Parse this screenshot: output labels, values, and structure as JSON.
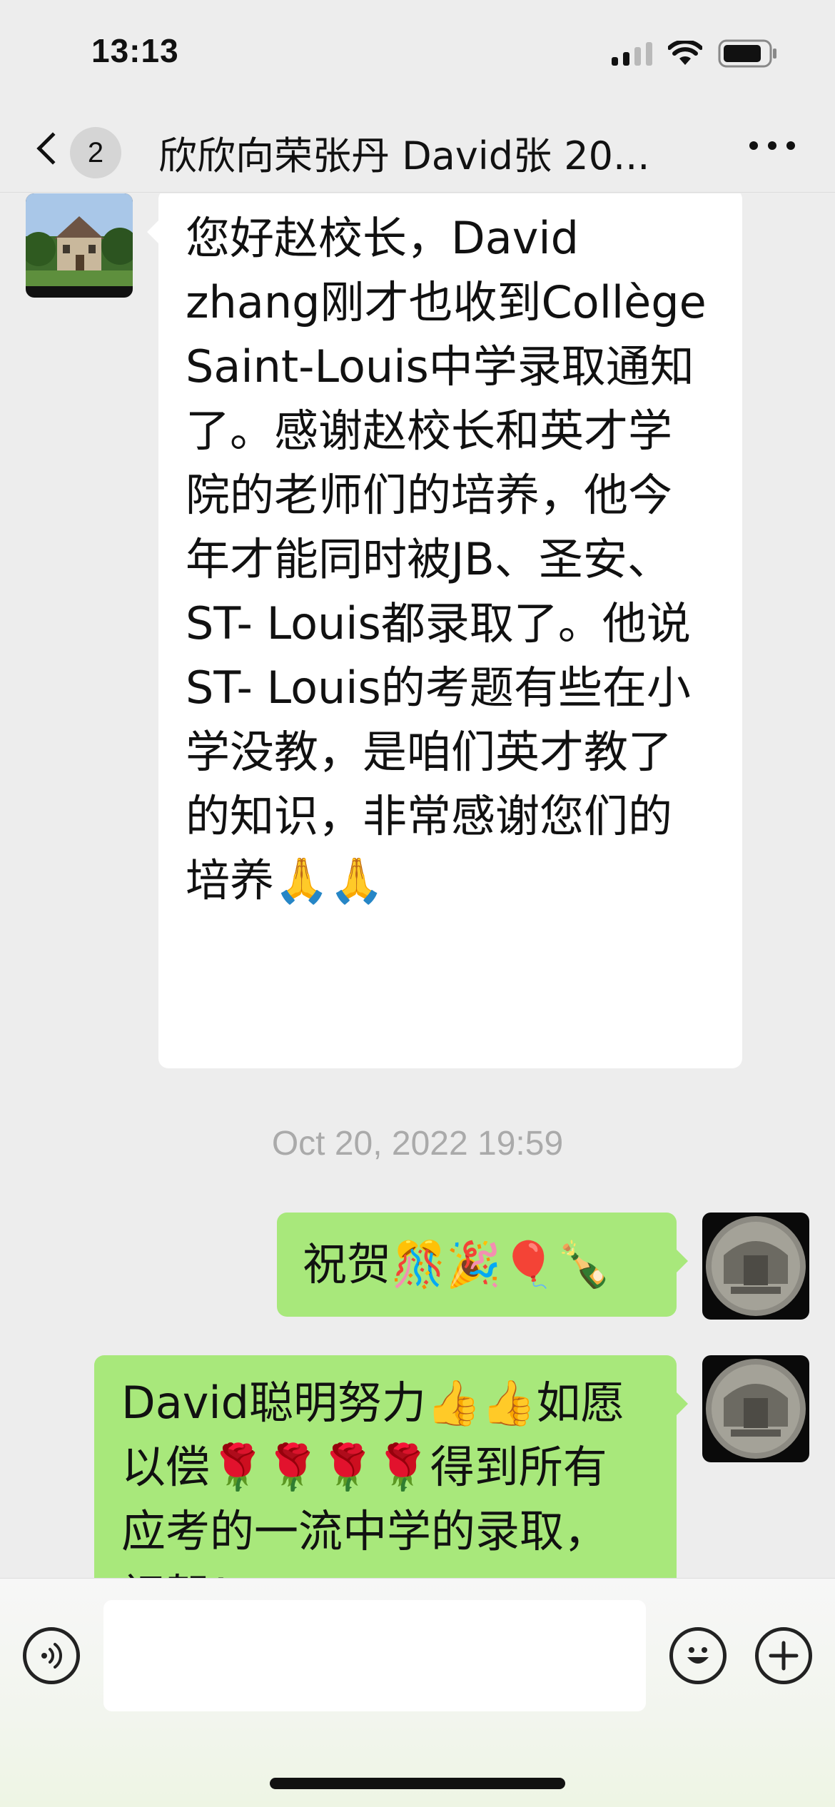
{
  "status_bar": {
    "time": "13:13"
  },
  "nav": {
    "unread_count": "2",
    "title": "欣欣向荣张丹 David张 20..."
  },
  "messages": {
    "incoming": {
      "text": "您好赵校长，David zhang刚才也收到Collège Saint-Louis中学录取通知了。感谢赵校长和英才学院的老师们的培养，他今年才能同时被JB、圣安、ST- Louis都录取了。他说ST- Louis的考题有些在小学没教，是咱们英才教了的知识，非常感谢您们的培养🙏🙏"
    },
    "timestamp": "Oct 20, 2022 19:59",
    "outgoing_1": {
      "text": "祝贺🎊🎉🎈🍾"
    },
    "outgoing_2": {
      "text": "David聪明努力👍👍如愿以偿🌹🌹🌹🌹得到所有应考的一流中学的录取，祝贺！"
    }
  },
  "colors": {
    "background": "#ededed",
    "incoming_bubble": "#ffffff",
    "outgoing_bubble": "#a8e87b",
    "timestamp": "#aaaaaa"
  },
  "icons": {
    "status": [
      "cellular-signal-icon",
      "wifi-icon",
      "battery-icon"
    ],
    "input_bar": [
      "voice-icon",
      "emoji-icon",
      "add-icon"
    ]
  }
}
